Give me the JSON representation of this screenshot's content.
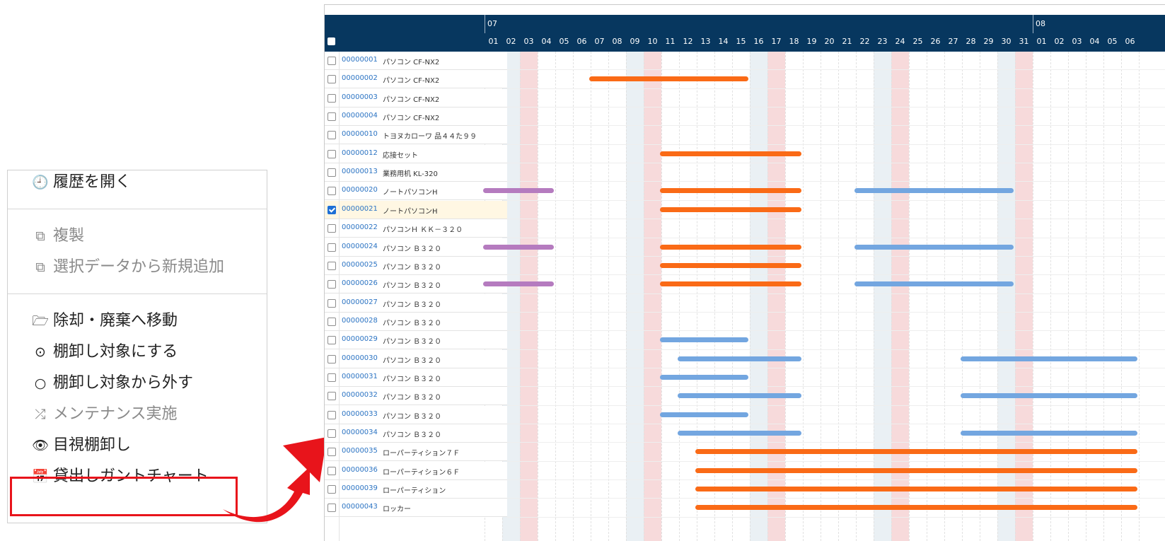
{
  "menu": {
    "items": [
      {
        "id": "open-history",
        "label": "履歴を開く",
        "icon": "clock-icon",
        "glyph": "🕘",
        "enabled": true
      },
      {
        "id": "duplicate",
        "label": "複製",
        "icon": "copy-icon",
        "glyph": "⧉",
        "enabled": false
      },
      {
        "id": "add-from-selection",
        "label": "選択データから新規追加",
        "icon": "copy-icon",
        "glyph": "⧉",
        "enabled": false
      },
      {
        "id": "move-to-disposal",
        "label": "除却・廃棄へ移動",
        "icon": "folder-open-icon",
        "glyph": "🗁",
        "enabled": true
      },
      {
        "id": "set-inventory-target",
        "label": "棚卸し対象にする",
        "icon": "dot-circle-icon",
        "glyph": "⊙",
        "enabled": true
      },
      {
        "id": "remove-inventory-target",
        "label": "棚卸し対象から外す",
        "icon": "circle-icon",
        "glyph": "○",
        "enabled": true
      },
      {
        "id": "maintenance",
        "label": "メンテナンス実施",
        "icon": "random-icon",
        "glyph": "⤮",
        "enabled": false
      },
      {
        "id": "visual-inventory",
        "label": "目視棚卸し",
        "icon": "eye-icon",
        "glyph": "👁",
        "enabled": true
      },
      {
        "id": "lending-gantt",
        "label": "貸出しガントチャート",
        "icon": "calendar-icon",
        "glyph": "📅",
        "enabled": true
      }
    ]
  },
  "gantt": {
    "months": [
      {
        "label": "07",
        "start_index": 0
      },
      {
        "label": "08",
        "start_index": 31
      }
    ],
    "days": [
      "01",
      "02",
      "03",
      "04",
      "05",
      "06",
      "07",
      "08",
      "09",
      "10",
      "11",
      "12",
      "13",
      "14",
      "15",
      "16",
      "17",
      "18",
      "19",
      "20",
      "21",
      "22",
      "23",
      "24",
      "25",
      "26",
      "27",
      "28",
      "29",
      "30",
      "31",
      "01",
      "02",
      "03",
      "04",
      "05",
      "06"
    ],
    "weekend_columns": {
      "saturday": [
        1,
        8,
        15,
        22,
        29
      ],
      "sunday": [
        2,
        9,
        16,
        23,
        30
      ]
    },
    "colors": {
      "orange": "#fa6a16",
      "blue": "#73a6e0",
      "purple": "#b57bbf",
      "saturday": "#eaf0f4",
      "sunday": "#f7dadb",
      "header": "#07375f",
      "highlight": "#e8141b"
    },
    "rows": [
      {
        "id": "00000001",
        "name": "パソコン CF-NX2",
        "checked": false,
        "bars": []
      },
      {
        "id": "00000002",
        "name": "パソコン CF-NX2",
        "checked": false,
        "bars": [
          {
            "color": "orange",
            "start": 6,
            "end": 14
          }
        ]
      },
      {
        "id": "00000003",
        "name": "パソコン CF-NX2",
        "checked": false,
        "bars": []
      },
      {
        "id": "00000004",
        "name": "パソコン CF-NX2",
        "checked": false,
        "bars": []
      },
      {
        "id": "00000010",
        "name": "トヨヌカローワ 品４４た９９",
        "checked": false,
        "bars": []
      },
      {
        "id": "00000012",
        "name": "応接セット",
        "checked": false,
        "bars": [
          {
            "color": "orange",
            "start": 10,
            "end": 17
          }
        ]
      },
      {
        "id": "00000013",
        "name": "業務用机 KL-320",
        "checked": false,
        "bars": []
      },
      {
        "id": "00000020",
        "name": "ノートパソコンH",
        "checked": false,
        "bars": [
          {
            "color": "purple",
            "start": 0,
            "end": 3
          },
          {
            "color": "orange",
            "start": 10,
            "end": 17
          },
          {
            "color": "blue",
            "start": 21,
            "end": 29
          }
        ]
      },
      {
        "id": "00000021",
        "name": "ノートパソコンH",
        "checked": true,
        "bars": [
          {
            "color": "orange",
            "start": 10,
            "end": 17
          }
        ]
      },
      {
        "id": "00000022",
        "name": "パソコンＨ ＫＫ－３２０",
        "checked": false,
        "bars": []
      },
      {
        "id": "00000024",
        "name": "パソコン Ｂ３２０",
        "checked": false,
        "bars": [
          {
            "color": "purple",
            "start": 0,
            "end": 3
          },
          {
            "color": "orange",
            "start": 10,
            "end": 17
          },
          {
            "color": "blue",
            "start": 21,
            "end": 29
          }
        ]
      },
      {
        "id": "00000025",
        "name": "パソコン Ｂ３２０",
        "checked": false,
        "bars": [
          {
            "color": "orange",
            "start": 10,
            "end": 17
          }
        ]
      },
      {
        "id": "00000026",
        "name": "パソコン Ｂ３２０",
        "checked": false,
        "bars": [
          {
            "color": "purple",
            "start": 0,
            "end": 3
          },
          {
            "color": "orange",
            "start": 10,
            "end": 17
          },
          {
            "color": "blue",
            "start": 21,
            "end": 29
          }
        ]
      },
      {
        "id": "00000027",
        "name": "パソコン Ｂ３２０",
        "checked": false,
        "bars": []
      },
      {
        "id": "00000028",
        "name": "パソコン Ｂ３２０",
        "checked": false,
        "bars": []
      },
      {
        "id": "00000029",
        "name": "パソコン Ｂ３２０",
        "checked": false,
        "bars": [
          {
            "color": "blue",
            "start": 10,
            "end": 14
          }
        ]
      },
      {
        "id": "00000030",
        "name": "パソコン Ｂ３２０",
        "checked": false,
        "bars": [
          {
            "color": "blue",
            "start": 11,
            "end": 17
          },
          {
            "color": "blue",
            "start": 27,
            "end": 36
          }
        ]
      },
      {
        "id": "00000031",
        "name": "パソコン Ｂ３２０",
        "checked": false,
        "bars": [
          {
            "color": "blue",
            "start": 10,
            "end": 14
          }
        ]
      },
      {
        "id": "00000032",
        "name": "パソコン Ｂ３２０",
        "checked": false,
        "bars": [
          {
            "color": "blue",
            "start": 11,
            "end": 17
          },
          {
            "color": "blue",
            "start": 27,
            "end": 36
          }
        ]
      },
      {
        "id": "00000033",
        "name": "パソコン Ｂ３２０",
        "checked": false,
        "bars": [
          {
            "color": "blue",
            "start": 10,
            "end": 14
          }
        ]
      },
      {
        "id": "00000034",
        "name": "パソコン Ｂ３２０",
        "checked": false,
        "bars": [
          {
            "color": "blue",
            "start": 11,
            "end": 17
          },
          {
            "color": "blue",
            "start": 27,
            "end": 36
          }
        ]
      },
      {
        "id": "00000035",
        "name": "ローパーティション７Ｆ",
        "checked": false,
        "bars": [
          {
            "color": "orange",
            "start": 12,
            "end": 36
          }
        ]
      },
      {
        "id": "00000036",
        "name": "ローパーティション６Ｆ",
        "checked": false,
        "bars": [
          {
            "color": "orange",
            "start": 12,
            "end": 36
          }
        ]
      },
      {
        "id": "00000039",
        "name": "ローパーティション",
        "checked": false,
        "bars": [
          {
            "color": "orange",
            "start": 12,
            "end": 36
          }
        ]
      },
      {
        "id": "00000043",
        "name": "ロッカー",
        "checked": false,
        "bars": [
          {
            "color": "orange",
            "start": 12,
            "end": 36
          }
        ]
      }
    ]
  }
}
